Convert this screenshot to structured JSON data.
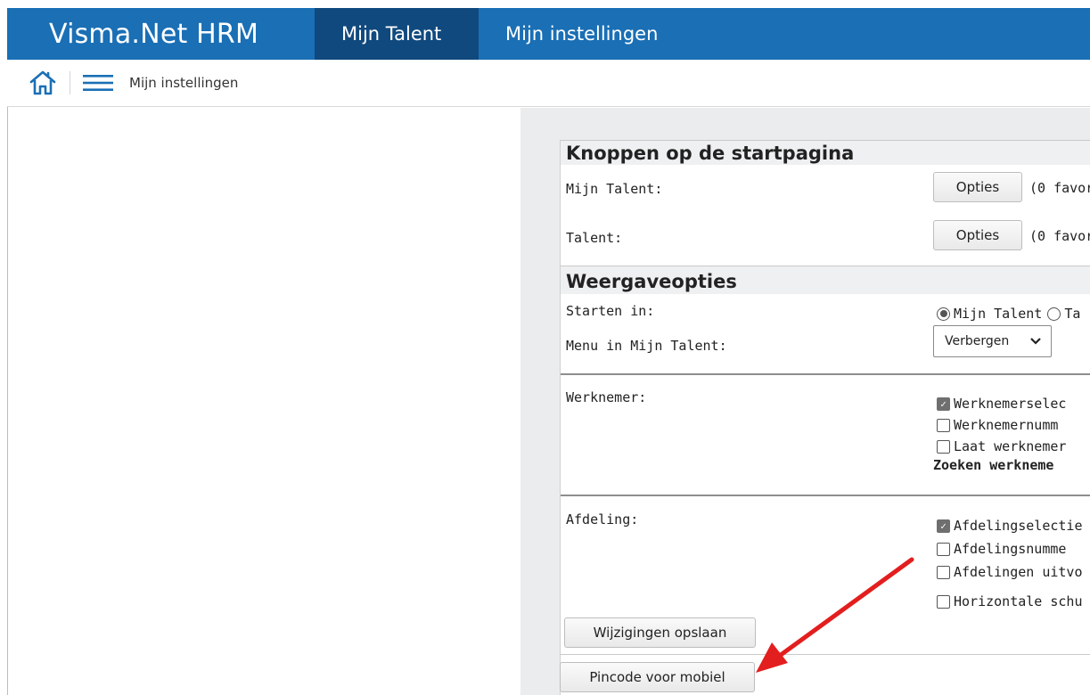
{
  "app": {
    "brand": "Visma.Net HRM",
    "tabs": [
      {
        "label": "Mijn Talent",
        "active": true
      },
      {
        "label": "Mijn instellingen",
        "active": false
      }
    ],
    "accent_color": "#1a6fb5",
    "active_tab_color": "#10497e"
  },
  "breadcrumb": {
    "current": "Mijn instellingen"
  },
  "sections": {
    "buttons": {
      "title": "Knoppen op de startpagina",
      "rows": [
        {
          "label": "Mijn Talent:",
          "button": "Opties",
          "info": "(0 favor"
        },
        {
          "label": "Talent:",
          "button": "Opties",
          "info": "(0 favor"
        }
      ]
    },
    "display": {
      "title": "Weergaveopties",
      "start_label": "Starten in:",
      "start_options": [
        {
          "label": "Mijn Talent",
          "checked": true
        },
        {
          "label": "Ta",
          "checked": false
        }
      ],
      "menu_label": "Menu in Mijn Talent:",
      "menu_value": "Verbergen"
    },
    "employee": {
      "label": "Werknemer:",
      "options": [
        {
          "label": "Werknemerselec",
          "checked": true
        },
        {
          "label": "Werknemernumm",
          "checked": false
        },
        {
          "label": "Laat werknemer",
          "checked": false
        }
      ],
      "bold_text": "Zoeken werkneme"
    },
    "department": {
      "label": "Afdeling:",
      "options": [
        {
          "label": "Afdelingselectie v",
          "checked": true
        },
        {
          "label": "Afdelingsnumme",
          "checked": false
        },
        {
          "label": "Afdelingen uitvo",
          "checked": false
        },
        {
          "label": "Horizontale schu",
          "checked": false
        }
      ]
    }
  },
  "actions": {
    "save": "Wijzigingen opslaan",
    "pincode": "Pincode voor mobiel"
  },
  "icons": [
    "home-icon",
    "hamburger-menu-icon",
    "chevron-down-icon",
    "check-icon",
    "red-arrow-annotation"
  ],
  "annotation_color": "#e31e1e"
}
